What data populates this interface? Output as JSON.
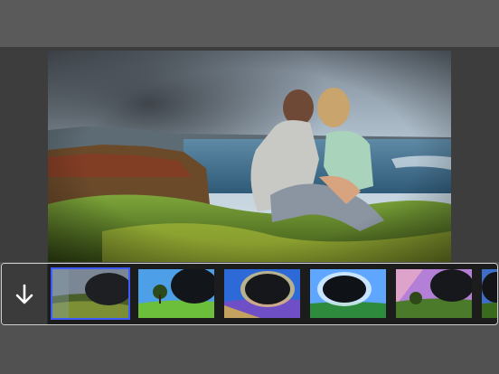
{
  "app": {
    "accent": "#3d5bff",
    "toolbar_background": "#5a5a5a",
    "stage_background": "#3d3d3d"
  },
  "filmstrip": {
    "download_icon": "arrow-down-icon",
    "selected_index": 0,
    "frames": [
      {
        "name": "dark-eclipse",
        "sky": "#6b7a8a",
        "ground": "#4f6b2a"
      },
      {
        "name": "tree-field",
        "sky": "#4da0e8",
        "ground": "#6cbf3a"
      },
      {
        "name": "golden-glow",
        "sky": "#2d6ad8",
        "ground": "#6f4fc6"
      },
      {
        "name": "blue-ring",
        "sky": "#5ea6ff",
        "ground": "#2e8a3c"
      },
      {
        "name": "purple-sunset",
        "sky": "#b47fd6",
        "ground": "#4b7a2a"
      },
      {
        "name": "dark-partial",
        "sky": "#3f6ec8",
        "ground": "#3a6a1e"
      }
    ]
  }
}
